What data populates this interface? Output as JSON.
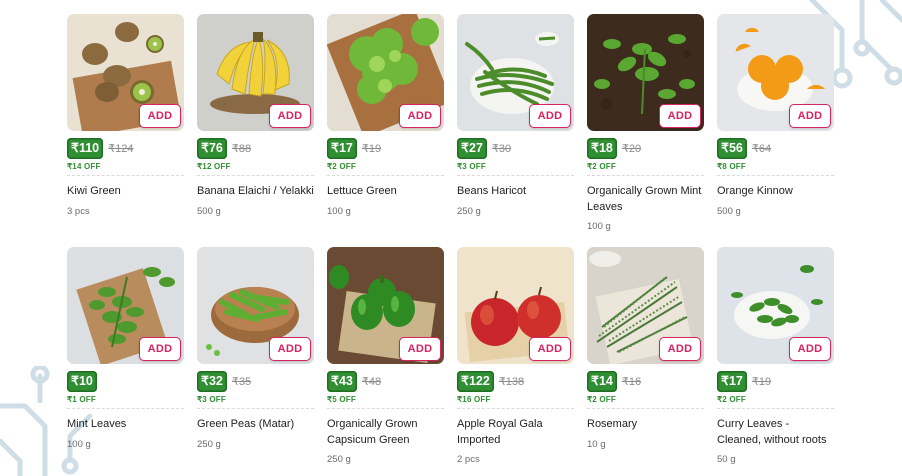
{
  "add_label": "ADD",
  "currency": "₹",
  "colors": {
    "accent": "#d6245f",
    "price_badge": "#2f8f32",
    "off_text": "#2f8f32"
  },
  "products": [
    {
      "name": "Kiwi Green",
      "price": "₹110",
      "mrp": "₹124",
      "off": "₹14 OFF",
      "qty": "3 pcs",
      "image_icon": "kiwi-image"
    },
    {
      "name": "Banana Elaichi / Yelakki",
      "price": "₹76",
      "mrp": "₹88",
      "off": "₹12 OFF",
      "qty": "500 g",
      "image_icon": "banana-image"
    },
    {
      "name": "Lettuce Green",
      "price": "₹17",
      "mrp": "₹19",
      "off": "₹2 OFF",
      "qty": "100 g",
      "image_icon": "lettuce-image"
    },
    {
      "name": "Beans Haricot",
      "price": "₹27",
      "mrp": "₹30",
      "off": "₹3 OFF",
      "qty": "250 g",
      "image_icon": "beans-image"
    },
    {
      "name": "Organically Grown Mint Leaves",
      "price": "₹18",
      "mrp": "₹20",
      "off": "₹2 OFF",
      "qty": "100 g",
      "image_icon": "mint-plant-image"
    },
    {
      "name": "Orange Kinnow",
      "price": "₹56",
      "mrp": "₹64",
      "off": "₹8 OFF",
      "qty": "500 g",
      "image_icon": "orange-image"
    },
    {
      "name": "Mint Leaves",
      "price": "₹10",
      "mrp": "",
      "off": "₹1 OFF",
      "qty": "100 g",
      "image_icon": "mint-image"
    },
    {
      "name": "Green Peas (Matar)",
      "price": "₹32",
      "mrp": "₹35",
      "off": "₹3 OFF",
      "qty": "250 g",
      "image_icon": "peas-image"
    },
    {
      "name": "Organically Grown Capsicum Green",
      "price": "₹43",
      "mrp": "₹48",
      "off": "₹5 OFF",
      "qty": "250 g",
      "image_icon": "capsicum-image"
    },
    {
      "name": "Apple Royal Gala Imported",
      "price": "₹122",
      "mrp": "₹138",
      "off": "₹16 OFF",
      "qty": "2 pcs",
      "image_icon": "apple-image"
    },
    {
      "name": "Rosemary",
      "price": "₹14",
      "mrp": "₹16",
      "off": "₹2 OFF",
      "qty": "10 g",
      "image_icon": "rosemary-image"
    },
    {
      "name": "Curry Leaves - Cleaned, without roots",
      "price": "₹17",
      "mrp": "₹19",
      "off": "₹2 OFF",
      "qty": "50 g",
      "image_icon": "curry-leaves-image"
    }
  ]
}
